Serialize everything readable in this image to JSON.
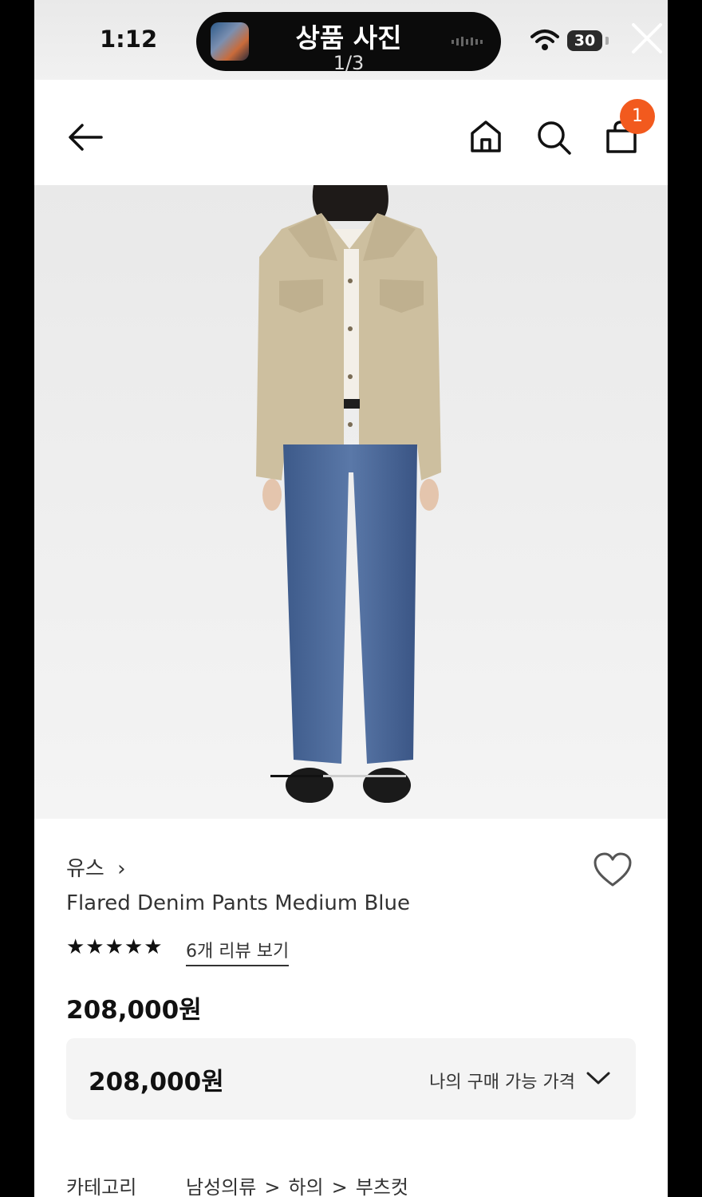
{
  "status_bar": {
    "time": "1:12",
    "battery": "30"
  },
  "viewer": {
    "title": "상품 사진",
    "page_indicator": "1/3"
  },
  "header": {
    "cart_badge": "1"
  },
  "product": {
    "brand": "유스",
    "brand_chevron": "›",
    "name": "Flared Denim Pants Medium Blue",
    "rating_stars": "★★★★★",
    "review_link": "6개 리뷰 보기",
    "price": "208,000원",
    "my_price_value": "208,000원",
    "my_price_label": "나의 구매 가능 가격"
  },
  "category": {
    "label": "카테고리",
    "path": [
      "남성의류",
      "하의",
      "부츠컷"
    ],
    "separator": ">"
  },
  "colors": {
    "accent": "#f25a1e",
    "background": "#ffffff",
    "text": "#222222"
  },
  "image_gallery": {
    "current_slide": 1,
    "total_slides": 3
  }
}
